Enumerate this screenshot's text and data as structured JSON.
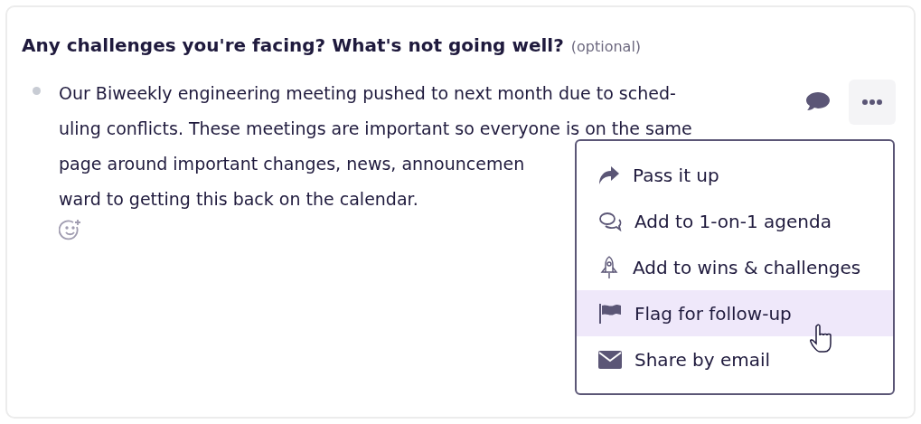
{
  "question": {
    "title": "Any challenges you're facing? What's not going well?",
    "hint": "(optional)"
  },
  "answer": {
    "lines": [
      "Our Biweekly engineering meeting pushed to next month due to sched-",
      "uling conflicts. These meetings are important so everyone is on the same",
      "page around important changes, news, announcemen",
      "ward to getting this back on the calendar."
    ]
  },
  "menu": {
    "open": true,
    "items": [
      {
        "kind": "share",
        "label": "Pass it up",
        "highlighted": false
      },
      {
        "kind": "chat",
        "label": "Add to 1-on-1 agenda",
        "highlighted": false
      },
      {
        "kind": "rocket",
        "label": "Add to wins & challenges",
        "highlighted": false
      },
      {
        "kind": "flag",
        "label": "Flag for follow-up",
        "highlighted": true
      },
      {
        "kind": "mail",
        "label": "Share by email",
        "highlighted": false
      }
    ]
  }
}
